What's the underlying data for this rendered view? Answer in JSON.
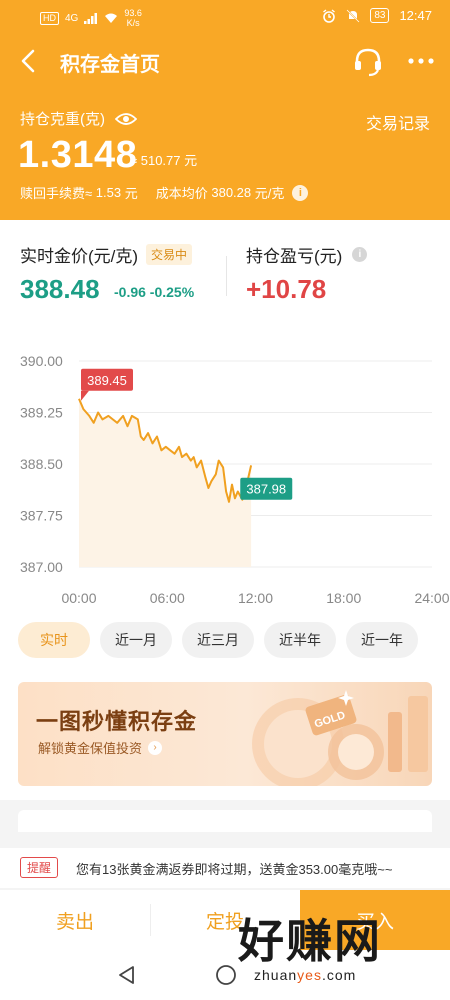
{
  "status_bar": {
    "network_label": "HD",
    "signal_label": "4G",
    "speed_value": "93.6",
    "speed_unit": "K/s",
    "battery": "83",
    "time": "12:47"
  },
  "nav": {
    "title": "积存金首页",
    "back_icon": "back-arrow-icon",
    "service_icon": "headset-icon",
    "more_icon": "more-icon"
  },
  "holding": {
    "label": "持仓克重(克)",
    "eye_icon": "eye-icon",
    "trade_record": "交易记录",
    "weight": "1.3148",
    "approx_value": "≈ 510.77 元",
    "fee_label": "赎回手续费≈",
    "fee_value": "1.53",
    "fee_unit": "元",
    "avg_cost_label": "成本均价",
    "avg_cost_value": "380.28",
    "avg_cost_unit": "元/克"
  },
  "market": {
    "price_label": "实时金价(元/克)",
    "status_badge": "交易中",
    "price": "388.48",
    "change": "-0.96 -0.25%",
    "pl_label": "持仓盈亏(元)",
    "pl_value": "+10.78"
  },
  "chart_data": {
    "type": "line",
    "ylim": [
      387.0,
      390.0
    ],
    "y_ticks": [
      "390.00",
      "389.25",
      "388.50",
      "387.75",
      "387.00"
    ],
    "x_ticks": [
      "00:00",
      "06:00",
      "12:00",
      "18:00",
      "24:00"
    ],
    "xlim": [
      0,
      24
    ],
    "high_label": "389.45",
    "low_label": "387.98",
    "series": [
      {
        "x": [
          0,
          0.3,
          0.7,
          1.0,
          1.3,
          1.6,
          2.0,
          2.3,
          2.6,
          3.0,
          3.3,
          3.6,
          4.0,
          4.2,
          4.4,
          4.7,
          5.0,
          5.3,
          5.6,
          5.9,
          6.2,
          6.5,
          6.8,
          7.0,
          7.3,
          7.6,
          7.8,
          8.0,
          8.3,
          8.6,
          8.8,
          9.0,
          9.3,
          9.5,
          9.8,
          10.0,
          10.2,
          10.4,
          10.6,
          10.8,
          11.1,
          11.4,
          11.7
        ],
        "values": [
          389.45,
          389.3,
          389.2,
          389.1,
          389.25,
          389.15,
          389.2,
          389.15,
          389.1,
          389.2,
          389.05,
          389.2,
          389.15,
          388.9,
          388.85,
          388.95,
          388.8,
          388.9,
          388.7,
          388.75,
          388.7,
          388.65,
          388.75,
          388.6,
          388.65,
          388.55,
          388.6,
          388.45,
          388.55,
          388.3,
          388.15,
          388.25,
          388.35,
          388.55,
          388.45,
          388.1,
          387.95,
          388.2,
          388.0,
          388.1,
          387.98,
          388.2,
          388.48
        ]
      }
    ]
  },
  "periods": [
    {
      "label": "实时",
      "active": true
    },
    {
      "label": "近一月",
      "active": false
    },
    {
      "label": "近三月",
      "active": false
    },
    {
      "label": "近半年",
      "active": false
    },
    {
      "label": "近一年",
      "active": false
    }
  ],
  "banner": {
    "title": "一图秒懂积存金",
    "subtitle": "解锁黄金保值投资",
    "gold_text": "GOLD"
  },
  "notice": {
    "badge": "提醒",
    "text": "您有13张黄金满返券即将过期，送黄金353.00毫克哦~~"
  },
  "actions": {
    "sell": "卖出",
    "fixed": "定投",
    "buy": "买入"
  },
  "watermark": {
    "main": "好赚网",
    "url_a": "zhuan",
    "url_b": "yes",
    "url_c": ".com"
  },
  "colors": {
    "brand": "#f9a826",
    "down": "#1d9e86",
    "up": "#e04545"
  }
}
